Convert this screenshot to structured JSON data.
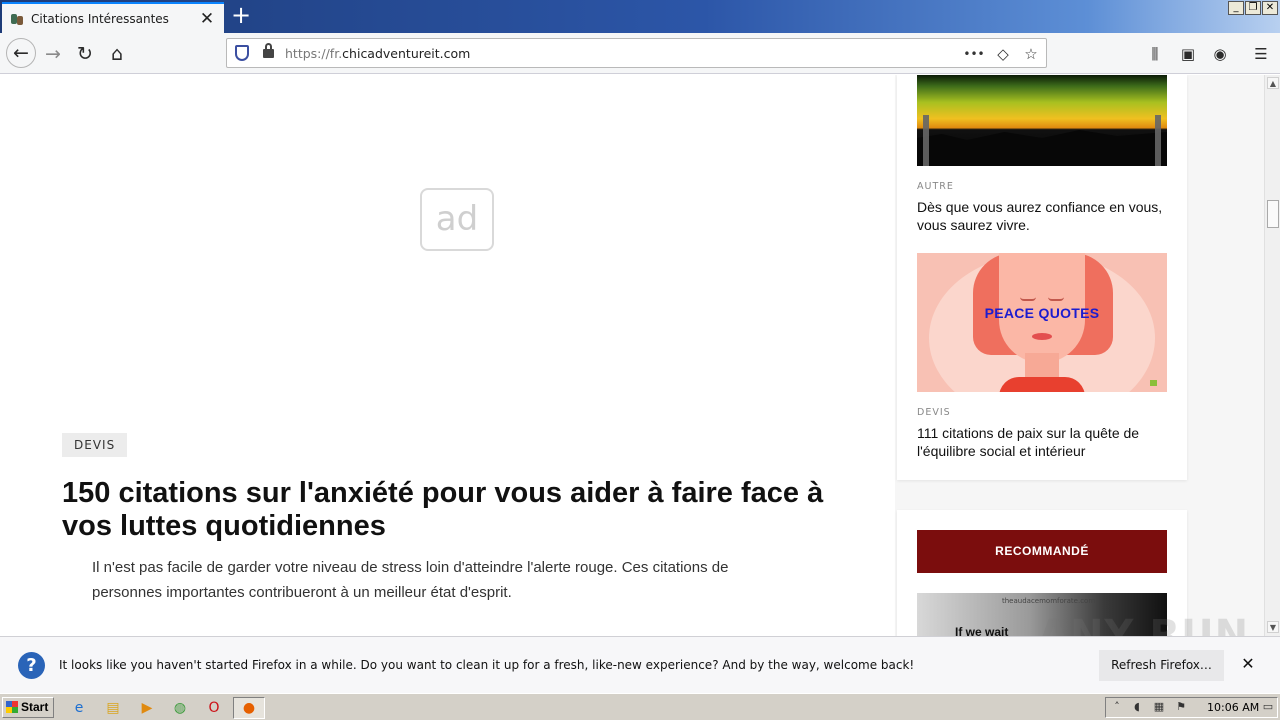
{
  "browser": {
    "tab_title": "Citations Intéressantes",
    "tab_close": "✕",
    "new_tab": "+",
    "url_prefix": "https://fr.",
    "url_domain": "chicadventureit.com",
    "url_more": "•••",
    "window_controls": [
      "_",
      "❐",
      "✕"
    ]
  },
  "page": {
    "ad_label": "ad",
    "article": {
      "category": "DEVIS",
      "title": "150 citations sur l'anxiété pour vous aider à faire face à vos luttes quotidiennes",
      "excerpt": "Il n'est pas facile de garder votre niveau de stress loin d'atteindre l'alerte rouge. Ces citations de personnes importantes contribueront à un meilleur état d'esprit."
    },
    "sidebar": {
      "cards": [
        {
          "category": "AUTRE",
          "title": "Dès que vous aurez confiance en vous, vous saurez vivre."
        },
        {
          "category": "DEVIS",
          "title": "111 citations de paix sur la quête de l'équilibre social et intérieur",
          "image_text": "PEACE QUOTES"
        }
      ],
      "recommended_label": "RECOMMANDÉ",
      "recommended_preview": {
        "site": "theaudacemomforate.com",
        "text": "If we wait"
      }
    }
  },
  "notification": {
    "message": "It looks like you haven't started Firefox in a while. Do you want to clean it up for a fresh, like-new experience? And by the way, welcome back!",
    "button": "Refresh Firefox…",
    "close": "✕"
  },
  "watermark": "ANY RUN",
  "taskbar": {
    "start_label": "Start",
    "clock": "10:06 AM"
  },
  "colors": {
    "recommended_bg": "#7b0d0d",
    "peace_quotes_text": "#1c1ccf",
    "tab_accent": "#0a84ff"
  }
}
